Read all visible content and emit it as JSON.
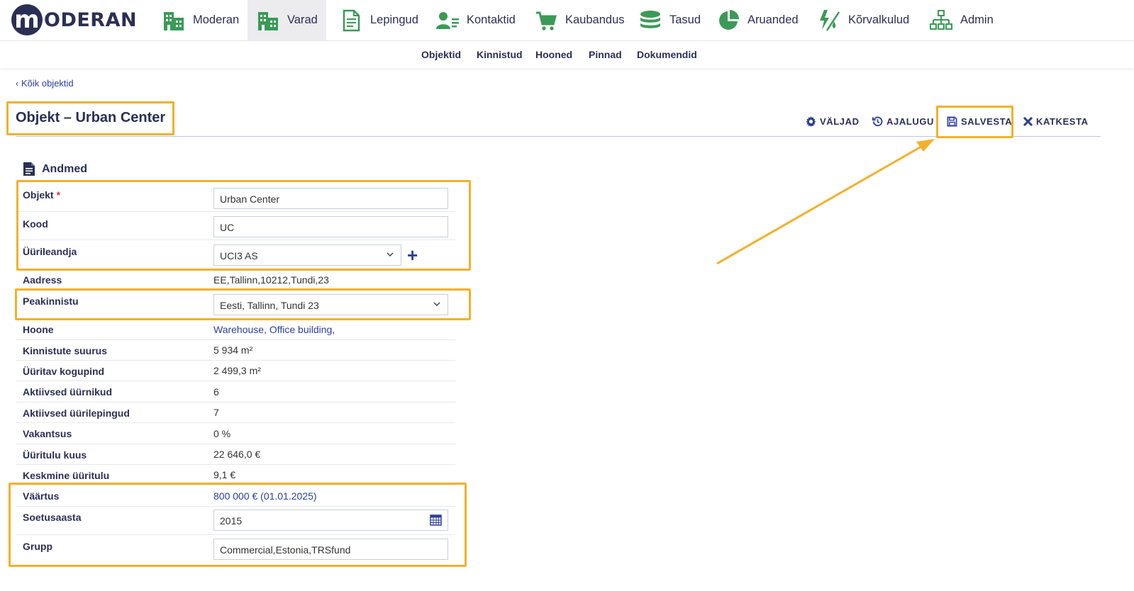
{
  "logo": {
    "mark": "m",
    "text": "ODERAN"
  },
  "nav": [
    {
      "label": "Moderan",
      "icon": "building-icon"
    },
    {
      "label": "Varad",
      "icon": "building-icon"
    },
    {
      "label": "Lepingud",
      "icon": "document-icon"
    },
    {
      "label": "Kontaktid",
      "icon": "contact-card-icon"
    },
    {
      "label": "Kaubandus",
      "icon": "shopping-cart-icon"
    },
    {
      "label": "Tasud",
      "icon": "coins-icon"
    },
    {
      "label": "Aruanded",
      "icon": "pie-chart-icon"
    },
    {
      "label": "Kõrvalkulud",
      "icon": "utilities-icon"
    },
    {
      "label": "Admin",
      "icon": "org-chart-icon"
    }
  ],
  "active_nav": "Varad",
  "subnav": [
    "Objektid",
    "Kinnistud",
    "Hooned",
    "Pinnad",
    "Dokumendid"
  ],
  "back_link": "‹ Kõik objektid",
  "page_title": "Objekt – Urban Center",
  "toolbar": {
    "fields": "VÄLJAD",
    "history": "AJALUGU",
    "save": "SALVESTA",
    "cancel": "KATKESTA"
  },
  "section": {
    "title": "Andmed",
    "icon": "document-icon"
  },
  "form": {
    "objekt": {
      "label": "Objekt",
      "required": "*",
      "value": "Urban Center"
    },
    "kood": {
      "label": "Kood",
      "value": "UC"
    },
    "uurileandja": {
      "label": "Üürileandja",
      "value": "UCI3 AS"
    },
    "aadress": {
      "label": "Aadress",
      "value": "EE,Tallinn,10212,Tundi,23"
    },
    "peakinnistu": {
      "label": "Peakinnistu",
      "value": "Eesti, Tallinn, Tundi 23"
    },
    "hoone": {
      "label": "Hoone",
      "value": "Warehouse, Office building,"
    },
    "kinnistute_suurus": {
      "label": "Kinnistute suurus",
      "value": "5 934 m²"
    },
    "uuritav_kogupind": {
      "label": "Üüritav kogupind",
      "value": "2 499,3 m²"
    },
    "aktiivsed_uurnikud": {
      "label": "Aktiivsed üürnikud",
      "value": "6"
    },
    "aktiivsed_uurilepingud": {
      "label": "Aktiivsed üürilepingud",
      "value": "7"
    },
    "vakantsus": {
      "label": "Vakantsus",
      "value": "0 %"
    },
    "uuritulu_kuus": {
      "label": "Üüritulu kuus",
      "value": "22 646,0 €"
    },
    "keskmine_uuritulu": {
      "label": "Keskmine üüritulu",
      "value": "9,1 €"
    },
    "vaartus": {
      "label": "Väärtus",
      "value": "800 000 € (01.01.2025)"
    },
    "soetusaasta": {
      "label": "Soetusaasta",
      "value": "2015"
    },
    "grupp": {
      "label": "Grupp",
      "value": "Commercial,Estonia,TRSfund"
    }
  },
  "colors": {
    "brand": "#2b2f55",
    "nav_icon": "#3a9a56",
    "link": "#2c3e9c",
    "highlight": "#f4b02a",
    "required": "#d9363e"
  }
}
